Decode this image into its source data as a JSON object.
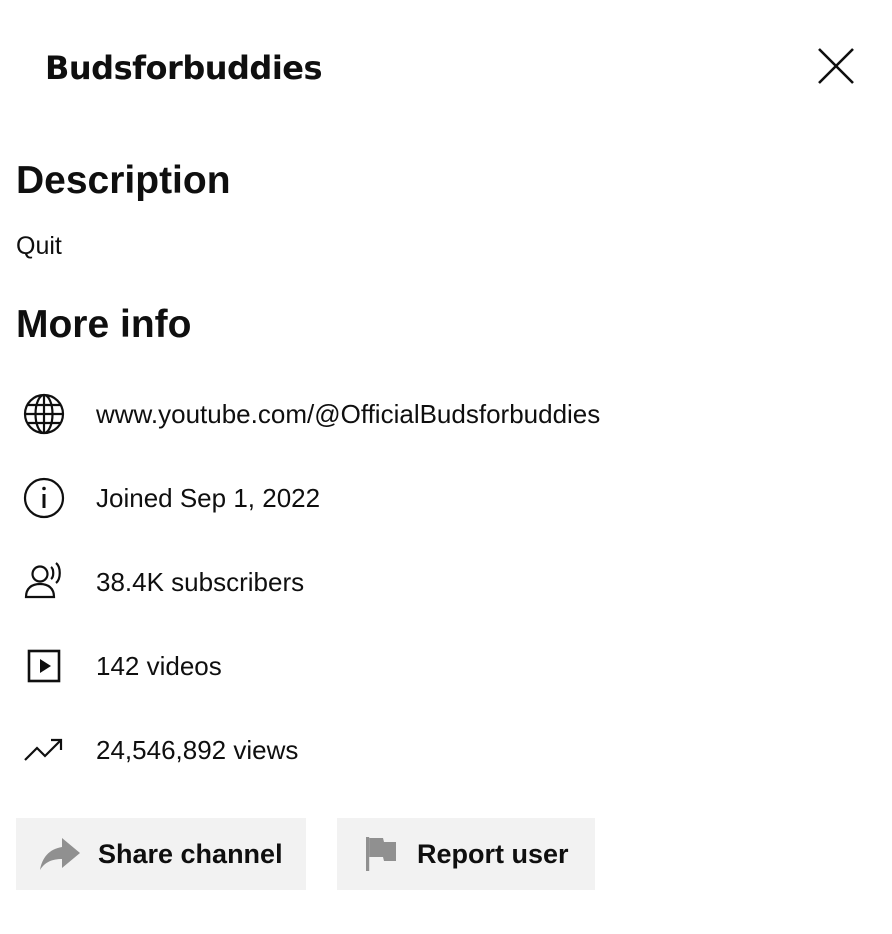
{
  "header": {
    "title": "Budsforbuddies"
  },
  "description": {
    "heading": "Description",
    "text": "Quit"
  },
  "more_info": {
    "heading": "More info",
    "items": [
      {
        "icon": "globe-icon",
        "text": "www.youtube.com/@OfficialBudsforbuddies"
      },
      {
        "icon": "info-icon",
        "text": "Joined Sep 1, 2022"
      },
      {
        "icon": "subscribers-icon",
        "text": "38.4K subscribers"
      },
      {
        "icon": "video-play-icon",
        "text": "142 videos"
      },
      {
        "icon": "trending-up-icon",
        "text": "24,546,892 views"
      }
    ]
  },
  "actions": {
    "share_label": "Share channel",
    "share_icon": "share-arrow-icon",
    "report_label": "Report user",
    "report_icon": "flag-icon"
  },
  "colors": {
    "text": "#0f0f0f",
    "button_bg": "#f2f2f2",
    "icon_gray": "#909090"
  }
}
